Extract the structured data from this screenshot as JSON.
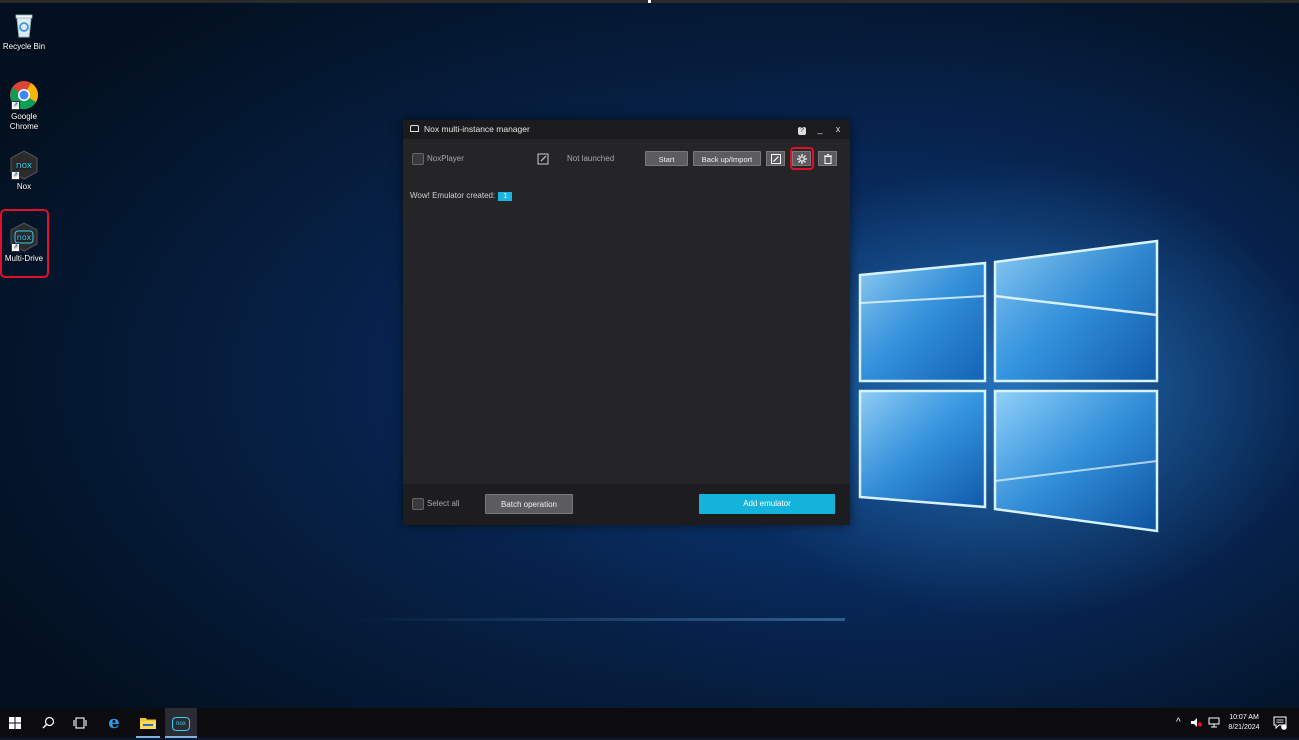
{
  "desktop": {
    "icons": [
      {
        "label": "Recycle Bin",
        "icon": "recycle-bin-icon"
      },
      {
        "label": "Google Chrome",
        "icon": "chrome-icon"
      },
      {
        "label": "Nox",
        "icon": "nox-icon"
      },
      {
        "label": "Multi-Drive",
        "icon": "nox-multi-drive-icon"
      }
    ]
  },
  "window": {
    "title": "Nox multi-instance manager",
    "title_icon": "nox-window-icon",
    "controls": {
      "help": "?",
      "minimize": "_",
      "close": "x"
    },
    "instance": {
      "name": "NoxPlayer",
      "status": "Not launched",
      "start_label": "Start",
      "backup_label": "Back up/Import",
      "icons": [
        "edit-icon",
        "shortcut-icon",
        "settings-icon",
        "delete-icon"
      ]
    },
    "created_text": "Wow! Emulator created:",
    "created_count": "1",
    "footer": {
      "select_all": "Select all",
      "batch_label": "Batch operation",
      "add_label": "Add emulator"
    }
  },
  "taskbar": {
    "items": [
      "start-icon",
      "search-icon",
      "task-view-icon",
      "edge-icon",
      "file-explorer-icon",
      "nox-taskbar-icon"
    ],
    "time": "10:07 AM",
    "date": "8/21/2024",
    "chevron": "^"
  },
  "colors": {
    "accent": "#13b3dc",
    "highlight": "#e0102a"
  }
}
